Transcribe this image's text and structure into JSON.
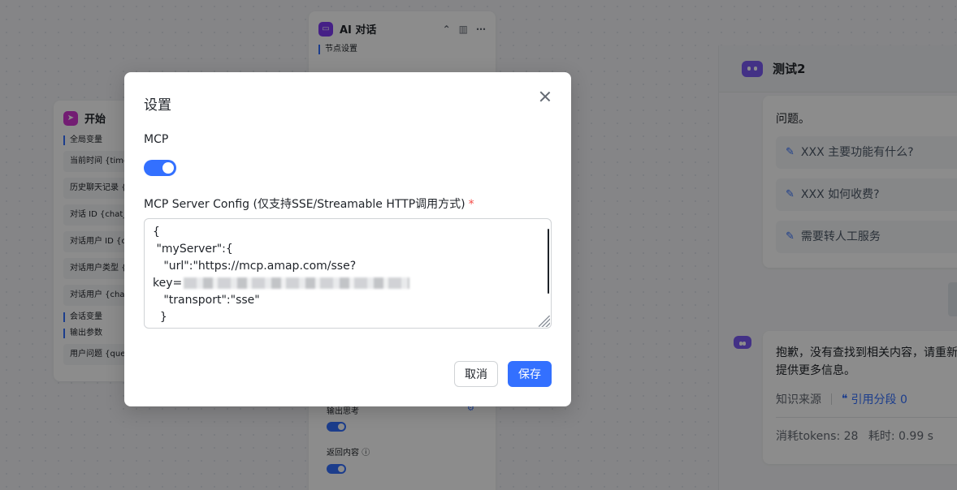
{
  "start_node": {
    "title": "开始",
    "section_global": "全局变量",
    "global_vars": [
      "当前时间 {time}",
      "历史聊天记录 {history}",
      "对话 ID {chat_id}",
      "对话用户 ID {chat_user_id}",
      "对话用户类型 {chat_user_type}",
      "对话用户 {chat_user}"
    ],
    "section_session": "会话变量",
    "section_output": "输出参数",
    "outputs": [
      "用户问题 {question}"
    ]
  },
  "ai_node": {
    "title": "AI 对话",
    "section_settings": "节点设置",
    "output_thinking": "输出思考",
    "return_content": "返回内容",
    "info_icon": "ⓘ"
  },
  "chat": {
    "title": "测试2",
    "fragment": "问题。",
    "questions": [
      "XXX 主要功能有什么?",
      "XXX 如何收费?",
      "需要转人工服务"
    ],
    "answer_line1": "抱歉，没有查找到相关内容，请重新",
    "answer_line2": "提供更多信息。",
    "knowledge_source": "知识来源",
    "cite_label": "引用分段 0",
    "tokens": "消耗tokens: 28",
    "time": "耗时: 0.99 s"
  },
  "modal": {
    "title": "设置",
    "mcp_label": "MCP",
    "mcp_enabled": true,
    "config_label": "MCP Server Config (仅支持SSE/Streamable HTTP调用方式)",
    "required_mark": "*",
    "config_lines": [
      "{",
      " \"myServer\":{",
      "   \"url\":\"https://mcp.amap.com/sse?",
      "key=",
      "   \"transport\":\"sse\"",
      "  }"
    ],
    "cancel_label": "取消",
    "save_label": "保存"
  },
  "colors": {
    "accent": "#3370ff",
    "required": "#f54a45"
  }
}
